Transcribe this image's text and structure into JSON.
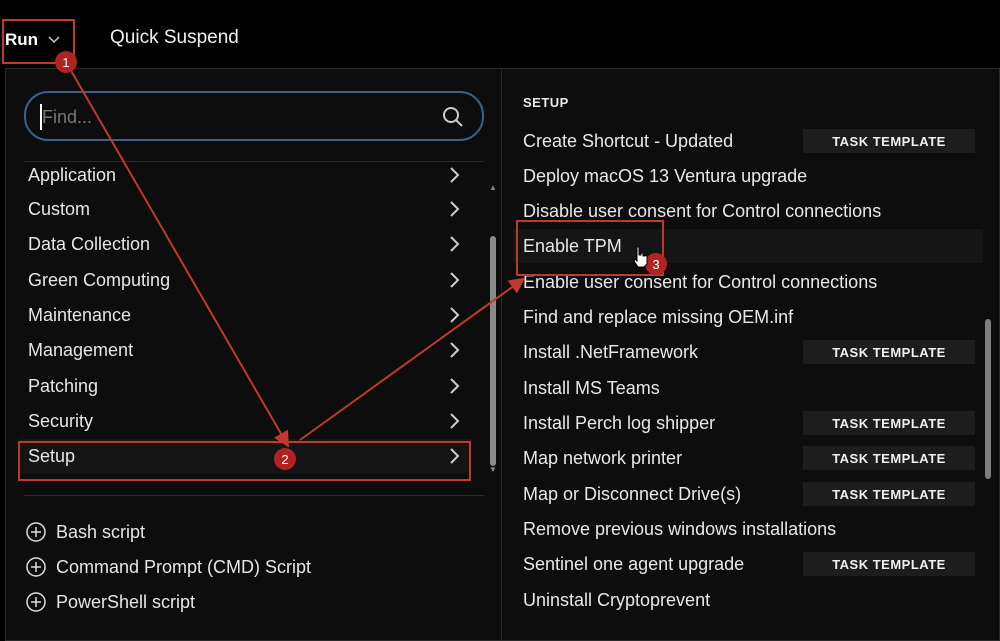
{
  "topbar": {
    "run_label": "Run",
    "quick_suspend_label": "Quick Suspend"
  },
  "search": {
    "placeholder": "Find..."
  },
  "categories": [
    {
      "label": "Application"
    },
    {
      "label": "Custom"
    },
    {
      "label": "Data Collection"
    },
    {
      "label": "Green Computing"
    },
    {
      "label": "Maintenance"
    },
    {
      "label": "Management"
    },
    {
      "label": "Patching"
    },
    {
      "label": "Security"
    },
    {
      "label": "Setup"
    }
  ],
  "add_actions": [
    {
      "label": "Bash script"
    },
    {
      "label": "Command Prompt (CMD) Script"
    },
    {
      "label": "PowerShell script"
    }
  ],
  "section_title": "SETUP",
  "task_badge_label": "TASK TEMPLATE",
  "setup_items": [
    {
      "label": "Create Shortcut - Updated",
      "badge": true
    },
    {
      "label": "Deploy macOS 13 Ventura upgrade",
      "badge": false
    },
    {
      "label": "Disable user consent for Control connections",
      "badge": false
    },
    {
      "label": "Enable TPM",
      "badge": false
    },
    {
      "label": "Enable user consent for Control connections",
      "badge": false
    },
    {
      "label": "Find and replace missing OEM.inf",
      "badge": false
    },
    {
      "label": "Install .NetFramework",
      "badge": true
    },
    {
      "label": "Install MS Teams",
      "badge": false
    },
    {
      "label": "Install Perch log shipper",
      "badge": true
    },
    {
      "label": "Map network printer",
      "badge": true
    },
    {
      "label": "Map or Disconnect Drive(s)",
      "badge": true
    },
    {
      "label": "Remove previous windows installations",
      "badge": false
    },
    {
      "label": "Sentinel one agent upgrade",
      "badge": true
    },
    {
      "label": "Uninstall Cryptoprevent",
      "badge": false
    }
  ],
  "annotations": {
    "step1": "1",
    "step2": "2",
    "step3": "3",
    "color": "#c0392b"
  },
  "icons": {
    "search": "search-icon",
    "chevron": "chevron-right-icon",
    "plus": "plus-circle-icon",
    "cursor": "hand-pointer-icon"
  }
}
